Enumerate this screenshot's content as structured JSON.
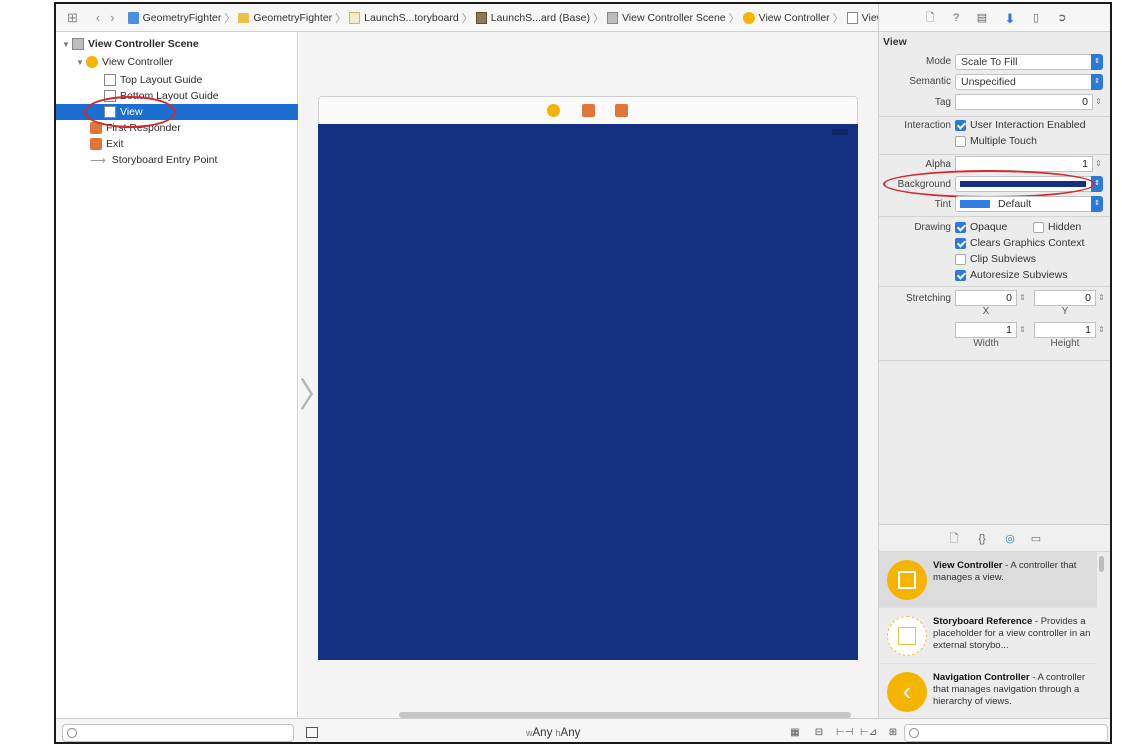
{
  "jumpbar": {
    "crumbs": [
      "GeometryFighter",
      "GeometryFighter",
      "LaunchS...toryboard",
      "LaunchS...ard (Base)",
      "View Controller Scene",
      "View Controller",
      "View"
    ]
  },
  "outline": {
    "items": [
      {
        "label": "View Controller Scene"
      },
      {
        "label": "View Controller"
      },
      {
        "label": "Top Layout Guide"
      },
      {
        "label": "Bottom Layout Guide"
      },
      {
        "label": "View"
      },
      {
        "label": "First Responder"
      },
      {
        "label": "Exit"
      },
      {
        "label": "Storyboard Entry Point"
      }
    ]
  },
  "canvas": {
    "view_background": "#143082"
  },
  "bottombar": {
    "size_w_prefix": "w",
    "size_w": "Any",
    "size_h_prefix": "h",
    "size_h": "Any"
  },
  "inspector": {
    "section_title": "View",
    "mode_label": "Mode",
    "mode_value": "Scale To Fill",
    "semantic_label": "Semantic",
    "semantic_value": "Unspecified",
    "tag_label": "Tag",
    "tag_value": "0",
    "interaction_label": "Interaction",
    "user_interaction": "User Interaction Enabled",
    "multiple_touch": "Multiple Touch",
    "alpha_label": "Alpha",
    "alpha_value": "1",
    "background_label": "Background",
    "background_color": "#143082",
    "tint_label": "Tint",
    "tint_value": "Default",
    "tint_color": "#2f7fe0",
    "drawing_label": "Drawing",
    "opaque": "Opaque",
    "hidden": "Hidden",
    "clears_graphics": "Clears Graphics Context",
    "clip_subviews": "Clip Subviews",
    "autoresize_subviews": "Autoresize Subviews",
    "stretching_label": "Stretching",
    "stretch_x_value": "0",
    "stretch_y_value": "0",
    "stretch_w_value": "1",
    "stretch_h_value": "1",
    "x_label": "X",
    "y_label": "Y",
    "width_label": "Width",
    "height_label": "Height"
  },
  "library": {
    "items": [
      {
        "title": "View Controller",
        "desc": " - A controller that manages a view."
      },
      {
        "title": "Storyboard Reference",
        "desc": " - Provides a placeholder for a view controller in an external storybo..."
      },
      {
        "title": "Navigation Controller",
        "desc": " - A controller that manages navigation through a hierarchy of views."
      }
    ]
  }
}
